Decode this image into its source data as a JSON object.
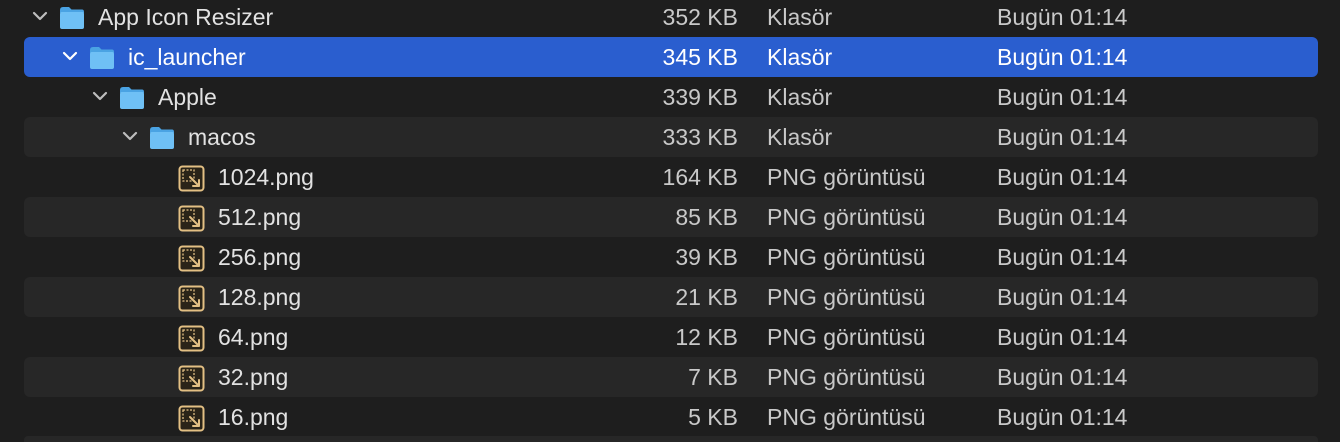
{
  "rows": [
    {
      "name": "App Icon Resizer",
      "size": "352 KB",
      "kind": "Klasör",
      "date": "Bugün 01:14",
      "type": "folder",
      "expanded": true
    },
    {
      "name": "ic_launcher",
      "size": "345 KB",
      "kind": "Klasör",
      "date": "Bugün 01:14",
      "type": "folder",
      "expanded": true,
      "selected": true
    },
    {
      "name": "Apple",
      "size": "339 KB",
      "kind": "Klasör",
      "date": "Bugün 01:14",
      "type": "folder",
      "expanded": true
    },
    {
      "name": "macos",
      "size": "333 KB",
      "kind": "Klasör",
      "date": "Bugün 01:14",
      "type": "folder",
      "expanded": true
    },
    {
      "name": "1024.png",
      "size": "164 KB",
      "kind": "PNG görüntüsü",
      "date": "Bugün 01:14",
      "type": "png"
    },
    {
      "name": "512.png",
      "size": "85 KB",
      "kind": "PNG görüntüsü",
      "date": "Bugün 01:14",
      "type": "png"
    },
    {
      "name": "256.png",
      "size": "39 KB",
      "kind": "PNG görüntüsü",
      "date": "Bugün 01:14",
      "type": "png"
    },
    {
      "name": "128.png",
      "size": "21 KB",
      "kind": "PNG görüntüsü",
      "date": "Bugün 01:14",
      "type": "png"
    },
    {
      "name": "64.png",
      "size": "12 KB",
      "kind": "PNG görüntüsü",
      "date": "Bugün 01:14",
      "type": "png"
    },
    {
      "name": "32.png",
      "size": "7 KB",
      "kind": "PNG görüntüsü",
      "date": "Bugün 01:14",
      "type": "png"
    },
    {
      "name": "16.png",
      "size": "5 KB",
      "kind": "PNG görüntüsü",
      "date": "Bugün 01:14",
      "type": "png"
    }
  ],
  "colors": {
    "background": "#1e1e1e",
    "alternate_row": "#272727",
    "selection": "#2a5ecf",
    "folder": "#5eb6f2"
  },
  "icons": {
    "folder": "folder-icon",
    "png": "png-file-icon",
    "disclosure": "chevron-down-icon"
  }
}
